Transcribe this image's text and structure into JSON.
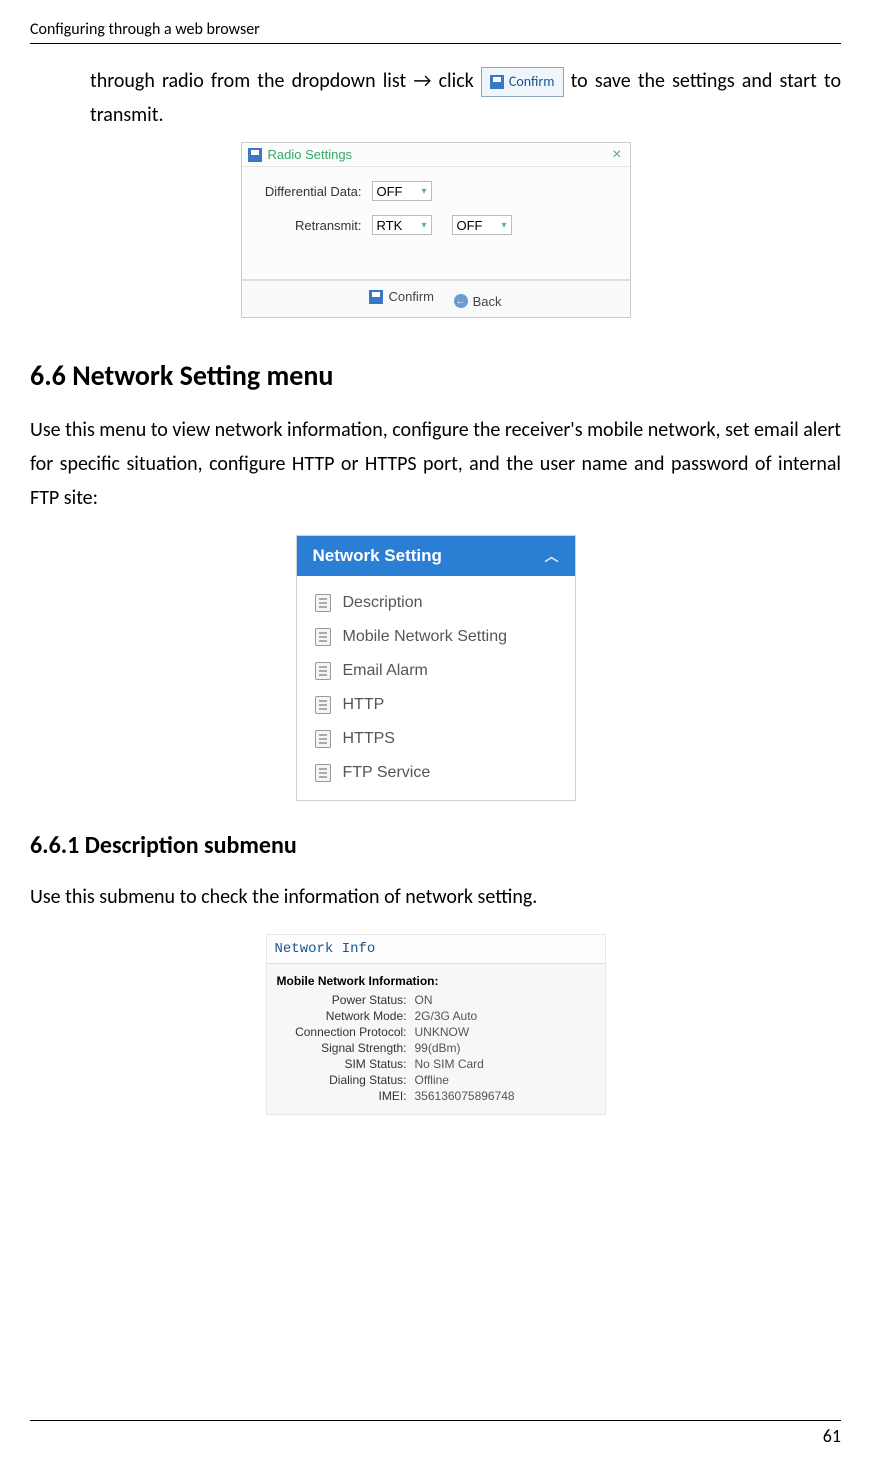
{
  "header": {
    "title": "Configuring through a web browser"
  },
  "paragraph1_pre": "through radio from the dropdown list → click ",
  "confirm_button_label": "Confirm",
  "paragraph1_post": " to save the settings and start to transmit.",
  "radio_settings": {
    "title": "Radio Settings",
    "rows": [
      {
        "label": "Differential Data:",
        "value1": "OFF"
      },
      {
        "label": "Retransmit:",
        "value1": "RTK",
        "value2": "OFF"
      }
    ],
    "confirm": "Confirm",
    "back": "Back"
  },
  "section_6_6": {
    "heading": "6.6  Network Setting menu",
    "body": "Use this menu to view network information, configure the receiver's mobile network, set email alert for specific situation, configure HTTP or HTTPS port, and the user name and password of internal FTP site:"
  },
  "network_sidebar": {
    "header": "Network Setting",
    "items": [
      "Description",
      "Mobile Network Setting",
      "Email Alarm",
      "HTTP",
      "HTTPS",
      "FTP Service"
    ]
  },
  "section_6_6_1": {
    "heading": "6.6.1  Description submenu",
    "body": "Use this submenu to check the information of network setting."
  },
  "network_info": {
    "title": "Network Info",
    "subtitle": "Mobile Network Information:",
    "rows": [
      {
        "label": "Power Status:",
        "value": "ON"
      },
      {
        "label": "Network Mode:",
        "value": "2G/3G Auto"
      },
      {
        "label": "Connection Protocol:",
        "value": "UNKNOW"
      },
      {
        "label": "Signal Strength:",
        "value": "99(dBm)"
      },
      {
        "label": "SIM Status:",
        "value": "No SIM Card"
      },
      {
        "label": "Dialing Status:",
        "value": "Offline"
      },
      {
        "label": "IMEI:",
        "value": "356136075896748"
      }
    ]
  },
  "page_number": "61"
}
